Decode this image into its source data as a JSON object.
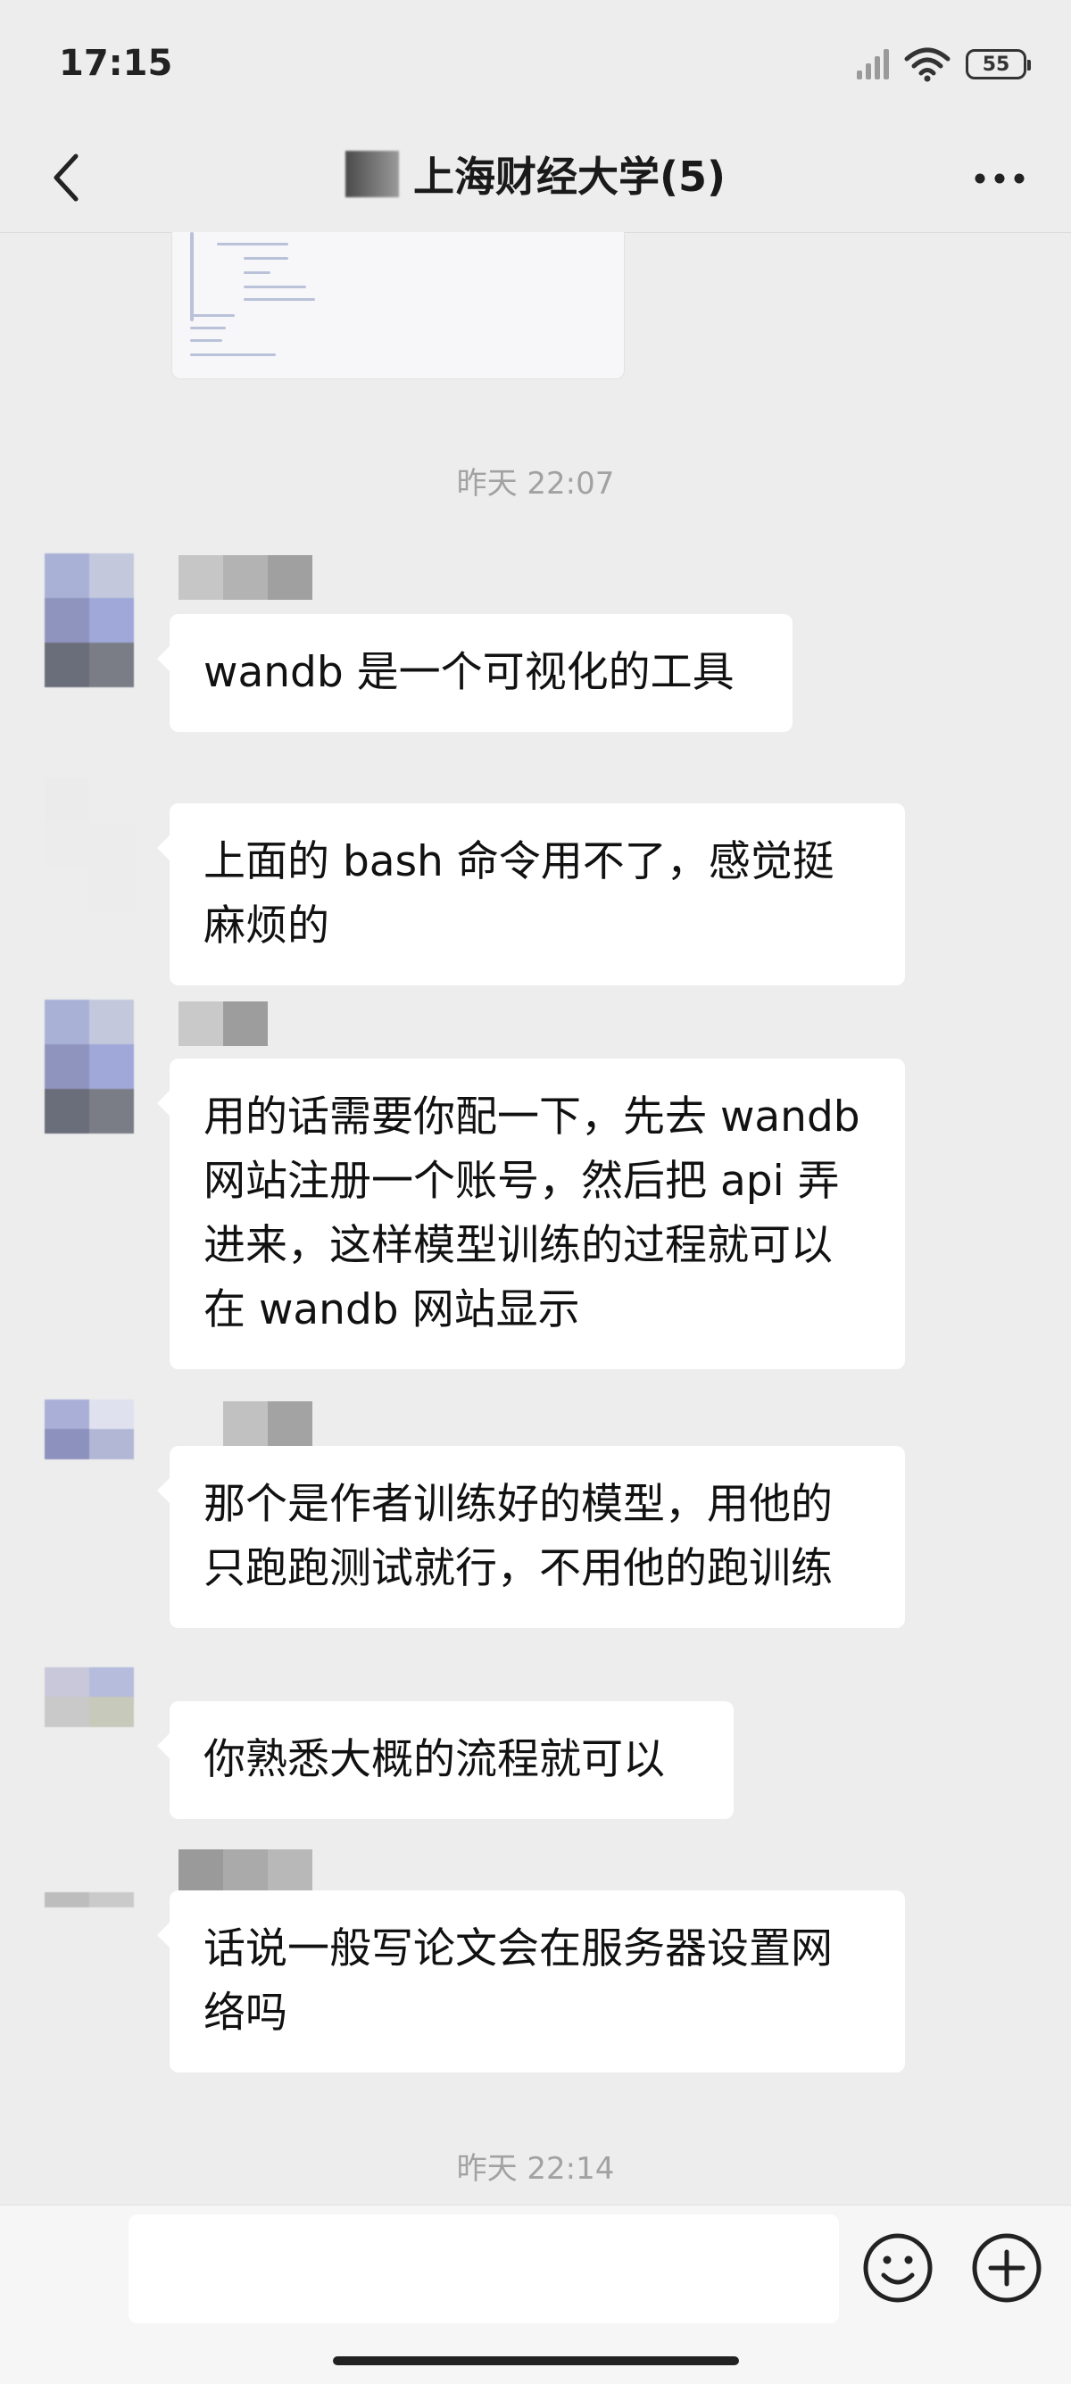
{
  "status_bar": {
    "time": "17:15",
    "battery": "55"
  },
  "header": {
    "title": "上海财经大学(5)"
  },
  "chat": {
    "timestamps": [
      "昨天 22:07",
      "昨天 22:14"
    ],
    "messages": [
      {
        "text": "wandb 是一个可视化的工具"
      },
      {
        "text": "上面的 bash 命令用不了，感觉挺麻烦的"
      },
      {
        "text": "用的话需要你配一下，先去 wandb 网站注册一个账号，然后把 api 弄进来，这样模型训练的过程就可以在 wandb 网站显示"
      },
      {
        "text": "那个是作者训练好的模型，用他的只跑跑测试就行，不用他的跑训练"
      },
      {
        "text": "你熟悉大概的流程就可以"
      },
      {
        "text": "话说一般写论文会在服务器设置网络吗"
      }
    ]
  },
  "input_bar": {
    "placeholder": ""
  },
  "icons": {
    "back": "chevron-left-icon",
    "more": "more-dots-icon",
    "emoji": "emoji-icon",
    "plus": "plus-icon",
    "wifi": "wifi-icon",
    "signal": "signal-icon",
    "battery": "battery-icon"
  }
}
